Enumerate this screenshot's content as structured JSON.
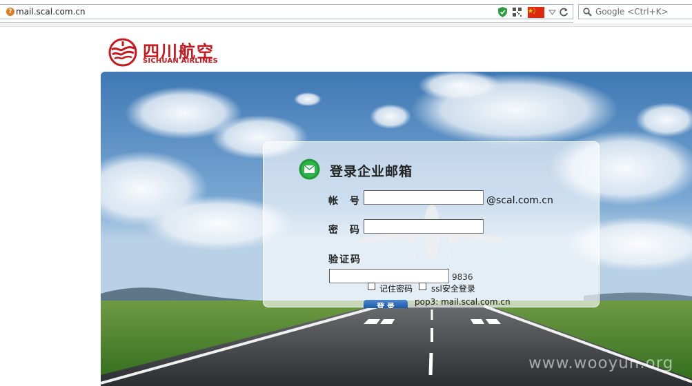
{
  "browser": {
    "url": "mail.scal.com.cn",
    "search_placeholder": "Google <Ctrl+K>",
    "icons": [
      "site-info-icon",
      "shield-icon",
      "qr-code-icon",
      "china-flag-icon",
      "dropdown-icon",
      "reload-icon",
      "search-icon"
    ]
  },
  "logo": {
    "name_cn": "四川航空",
    "name_en": "SICHUAN AIRLINES",
    "color": "#c8161d"
  },
  "login": {
    "title": "登录企业邮箱",
    "account_label": "帐 号",
    "account_value": "",
    "domain_suffix": "@scal.com.cn",
    "password_label": "密 码",
    "password_value": "",
    "captcha_label": "验证码",
    "captcha_value": "",
    "captcha_code": "9836",
    "remember_label": "记住密码",
    "ssl_label": "ssl安全登录",
    "login_button": "登 录",
    "pop3_info": "pop3: mail.scal.com.cn"
  },
  "watermark": "www.wooyun.org",
  "colors": {
    "sky": "#5a8fc2",
    "grass": "#4f8a2e",
    "runway": "#3a3c40",
    "button": "#2d6cbf"
  }
}
